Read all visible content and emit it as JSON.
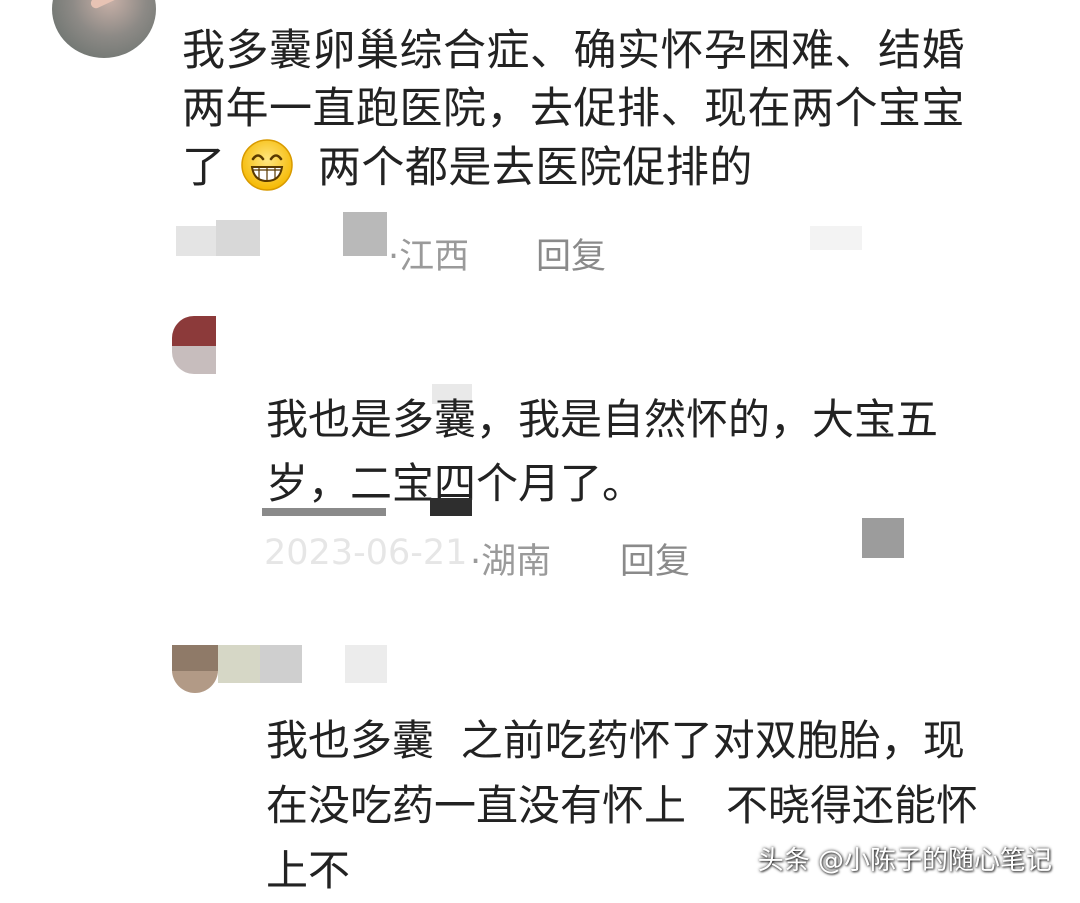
{
  "comments": [
    {
      "text_line1": "我多囊卵巢综合症、确实怀孕困难、结婚",
      "text_line2": "两年一直跑医院，去促排、现在两个宝宝",
      "text_line3_before": "了",
      "emoji": "grinning-face-emoji",
      "text_line3_after": "两个都是去医院促排的",
      "location": "·江西",
      "reply_label": "回复"
    },
    {
      "text_line1": "我也是多囊，我是自然怀的，大宝五",
      "text_line2": "岁，二宝四个月了。",
      "date_fragment": "2023-06-21",
      "location": "·湖南",
      "reply_label": "回复"
    },
    {
      "text_line1": "我也多囊  之前吃药怀了对双胞胎，现",
      "text_line2": "在没吃药一直没有怀上   不晓得还能怀",
      "text_line3": "上不"
    }
  ],
  "watermark": "头条 @小陈子的随心笔记"
}
